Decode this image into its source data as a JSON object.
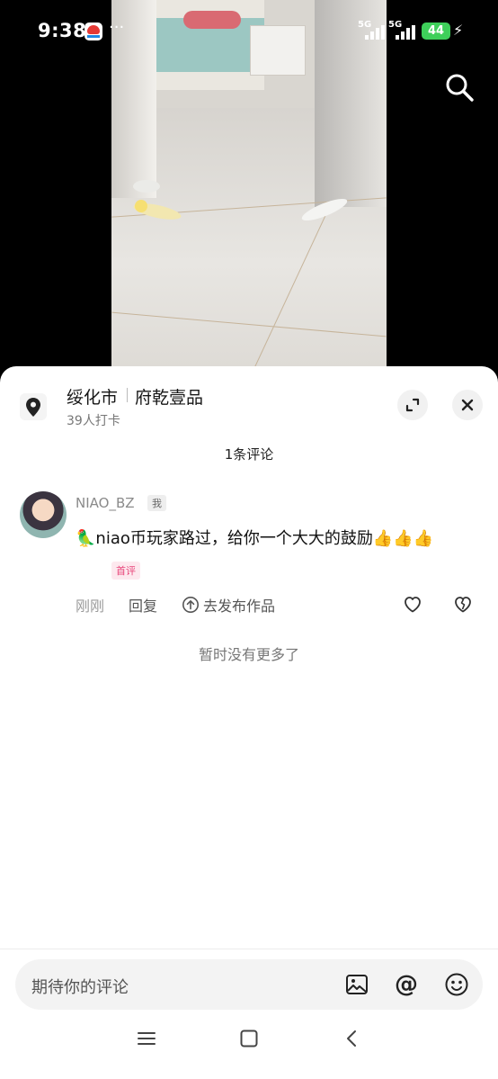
{
  "status_bar": {
    "time": "9:38",
    "dots": "···",
    "signal1_label": "5G",
    "signal2_label": "5G",
    "battery": "44",
    "charging_icon": "charging-bolt-icon"
  },
  "video": {
    "search_icon": "search-icon"
  },
  "location": {
    "city": "绥化市",
    "place": "府乾壹品",
    "checkins": "39人打卡"
  },
  "comments": {
    "count_label": "1条评论",
    "items": [
      {
        "username": "NIAO_BZ",
        "me_tag": "我",
        "text": "🦜niao币玩家路过，给你一个大大的鼓励👍👍👍",
        "first_tag": "首评",
        "time": "刚刚",
        "reply": "回复",
        "publish": "去发布作品"
      }
    ],
    "no_more": "暂时没有更多了"
  },
  "input": {
    "placeholder": "期待你的评论",
    "at_symbol": "@"
  },
  "nav": {
    "menu_icon": "menu-icon",
    "home_icon": "home-icon",
    "back_icon": "back-icon"
  }
}
